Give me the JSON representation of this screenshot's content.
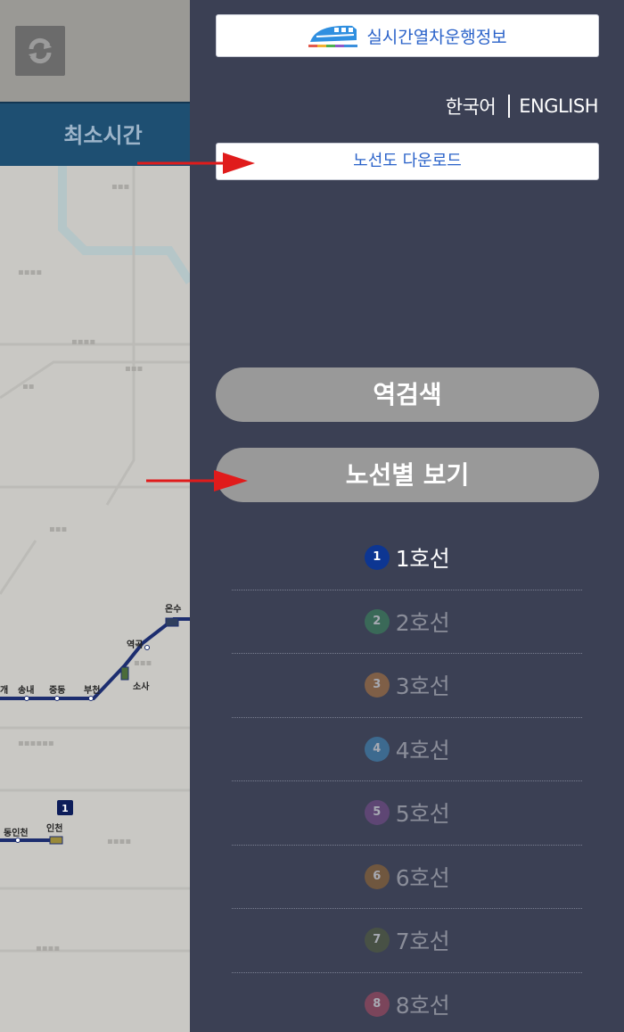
{
  "background": {
    "tab_label": "최소시간",
    "map_labels": {
      "onsu": "온수",
      "yeokgok": "역곡",
      "sosa": "소사",
      "bucheon": "부천",
      "jungdong": "중동",
      "songnae": "송내",
      "gae": "개",
      "dongincheon": "동인천",
      "incheon": "인천",
      "line1_marker": "1"
    }
  },
  "drawer": {
    "realtime_label": "실시간열차운행정보",
    "lang_korean": "한국어",
    "lang_english": "ENGLISH",
    "download_label": "노선도 다운로드",
    "station_search_label": "역검색",
    "line_view_label": "노선별 보기",
    "lines": [
      {
        "num": "1",
        "label": "1호선",
        "color": "#0d3692",
        "active": true
      },
      {
        "num": "2",
        "label": "2호선",
        "color": "#3a8b5c",
        "active": false
      },
      {
        "num": "3",
        "label": "3호선",
        "color": "#b87a3e",
        "active": false
      },
      {
        "num": "4",
        "label": "4호선",
        "color": "#3f8ec0",
        "active": false
      },
      {
        "num": "5",
        "label": "5호선",
        "color": "#7b4c8f",
        "active": false
      },
      {
        "num": "6",
        "label": "6호선",
        "color": "#9c6a2e",
        "active": false
      },
      {
        "num": "7",
        "label": "7호선",
        "color": "#53603a",
        "active": false
      },
      {
        "num": "8",
        "label": "8호선",
        "color": "#b04a62",
        "active": false
      }
    ]
  },
  "colors": {
    "drawer_bg": "#3b4054",
    "link_blue": "#2a62c9",
    "pill_gray": "#999999",
    "arrow_red": "#e01b1b"
  }
}
